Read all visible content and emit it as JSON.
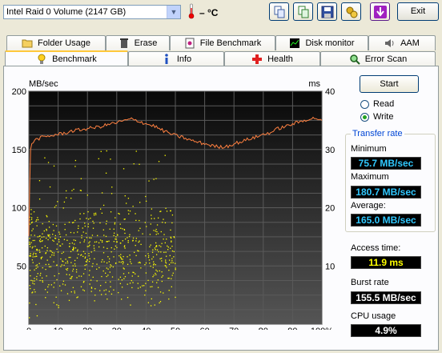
{
  "toolbar": {
    "drive": "Intel   Raid 0 Volume (2147 GB)",
    "temperature": "– °C",
    "exit_label": "Exit"
  },
  "tabs_row1": [
    {
      "label": "Folder Usage",
      "icon": "folder-icon"
    },
    {
      "label": "Erase",
      "icon": "trash-icon"
    },
    {
      "label": "File Benchmark",
      "icon": "file-benchmark-icon"
    },
    {
      "label": "Disk monitor",
      "icon": "disk-monitor-icon"
    },
    {
      "label": "AAM",
      "icon": "speaker-icon"
    }
  ],
  "tabs_row2": [
    {
      "label": "Benchmark",
      "icon": "lightbulb-icon",
      "active": true
    },
    {
      "label": "Info",
      "icon": "info-icon"
    },
    {
      "label": "Health",
      "icon": "health-cross-icon"
    },
    {
      "label": "Error Scan",
      "icon": "magnifier-icon"
    }
  ],
  "controls": {
    "start_label": "Start",
    "read_label": "Read",
    "write_label": "Write",
    "selected_mode": "Write"
  },
  "transfer_rate": {
    "legend": "Transfer rate",
    "minimum_label": "Minimum",
    "minimum_value": "75.7 MB/sec",
    "maximum_label": "Maximum",
    "maximum_value": "180.7 MB/sec",
    "average_label": "Average:",
    "average_value": "165.0 MB/sec"
  },
  "access_time": {
    "label": "Access time:",
    "value": "11.9 ms"
  },
  "burst_rate": {
    "label": "Burst rate",
    "value": "155.5 MB/sec"
  },
  "cpu_usage": {
    "label": "CPU usage",
    "value": "4.9%"
  },
  "chart_data": {
    "type": "line",
    "y_left_label": "MB/sec",
    "y_right_label": "ms",
    "y_left_ticks": [
      "200",
      "150",
      "100",
      "50",
      "0"
    ],
    "y_right_ticks": [
      "40",
      "30",
      "20",
      "10"
    ],
    "x_ticks": [
      "0",
      "10",
      "20",
      "30",
      "40",
      "50",
      "60",
      "70",
      "80",
      "90",
      "100%"
    ],
    "xlim": [
      0,
      100
    ],
    "ylim_left": [
      0,
      200
    ],
    "ylim_right": [
      0,
      40
    ],
    "grid": true,
    "series": [
      {
        "name": "transfer rate",
        "color": "#ff8040",
        "x": [
          0,
          0.3,
          0.6,
          1,
          2,
          4,
          6,
          8,
          10,
          12,
          15,
          18,
          20,
          23,
          25,
          28,
          30,
          33,
          35,
          38,
          40,
          43,
          45,
          48,
          50,
          53,
          55,
          58,
          60,
          63,
          65,
          68,
          70,
          73,
          75,
          78,
          80,
          83,
          85,
          88,
          90,
          93,
          95,
          98,
          100
        ],
        "y": [
          75.7,
          120,
          150,
          155,
          158,
          160,
          161,
          162,
          163,
          164,
          166,
          167,
          168,
          169,
          170,
          172,
          173,
          175,
          176,
          174,
          172,
          170,
          167,
          164,
          162,
          160,
          158,
          156,
          155,
          153,
          152,
          153,
          155,
          157,
          159,
          161,
          163,
          165,
          168,
          170,
          172,
          174,
          176,
          177,
          175
        ]
      },
      {
        "name": "access time",
        "color": "#ffff00",
        "type": "scatter",
        "x_range": [
          0,
          50
        ],
        "y_range_ms": [
          1,
          30
        ],
        "mean_ms": 11.9
      }
    ]
  }
}
